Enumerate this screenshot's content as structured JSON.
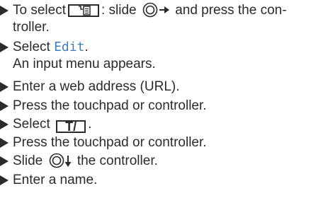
{
  "steps": [
    {
      "line1_before": "To select",
      "line1_after": ": slide",
      "line1_end": "and press the con-",
      "line2": "troller.",
      "icons": [
        "list-menu-icon",
        "controller-knob-icon",
        "arrow-right-icon"
      ]
    },
    {
      "line1_before": "Select",
      "line1_code": "Edit",
      "line1_after": ".",
      "line2": "An input menu appears."
    },
    {
      "line1": "Enter a web address (URL)."
    },
    {
      "line1": "Press the touchpad or controller."
    },
    {
      "line1_before": "Select",
      "button_label": "T/",
      "line1_after": "."
    },
    {
      "line1": "Press the touchpad or controller."
    },
    {
      "line1_before": "Slide",
      "line1_after": "the controller.",
      "icons": [
        "controller-knob-icon",
        "arrow-down-icon"
      ]
    },
    {
      "line1": "Enter a name."
    }
  ],
  "colors": {
    "text": "#2b2b2b",
    "code": "#3f7fbf"
  }
}
